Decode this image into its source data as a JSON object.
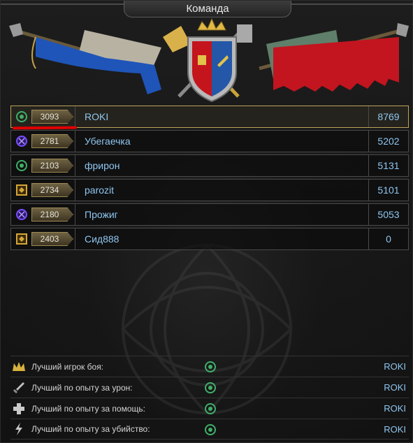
{
  "window": {
    "title": "Команда"
  },
  "team": [
    {
      "rank_icon": "green-rank-icon",
      "rating": "3093",
      "name": "ROKI",
      "score": "8769",
      "highlight": true
    },
    {
      "rank_icon": "purple-rank-icon",
      "rating": "2781",
      "name": "Убегаечка",
      "score": "5202"
    },
    {
      "rank_icon": "green-rank-icon",
      "rating": "2103",
      "name": "фрирон",
      "score": "5131"
    },
    {
      "rank_icon": "gold-rank-icon",
      "rating": "2734",
      "name": "parozit",
      "score": "5101"
    },
    {
      "rank_icon": "purple-rank-icon",
      "rating": "2180",
      "name": "Прожиг",
      "score": "5053"
    },
    {
      "rank_icon": "gold-rank-icon",
      "rating": "2403",
      "name": "Сид888",
      "score": "0"
    }
  ],
  "awards": [
    {
      "icon": "crown-icon",
      "label": "Лучший игрок боя:",
      "player": "ROKI"
    },
    {
      "icon": "sword-icon",
      "label": "Лучший по опыту за урон:",
      "player": "ROKI"
    },
    {
      "icon": "cross-plus-icon",
      "label": "Лучший по опыту за помощь:",
      "player": "ROKI"
    },
    {
      "icon": "lightning-icon",
      "label": "Лучший по опыту за убийство:",
      "player": "ROKI"
    }
  ],
  "colors": {
    "player_name": "#8fc6f0",
    "rank_green": "#3fb06a",
    "rank_purple": "#7a4cff",
    "rank_gold": "#d6a63a",
    "highlight_border": "#bba35a",
    "underline_mark": "#e00000"
  }
}
